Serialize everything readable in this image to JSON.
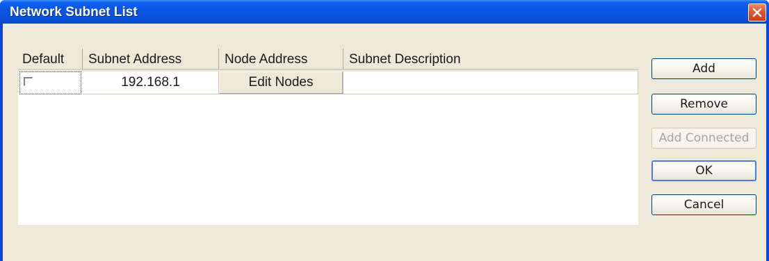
{
  "window": {
    "title": "Network Subnet List"
  },
  "table": {
    "columns": [
      "Default",
      "Subnet Address",
      "Node Address",
      "Subnet Description"
    ],
    "rows": [
      {
        "default_checked": false,
        "subnet_address": "192.168.1",
        "node_address_button": "Edit Nodes",
        "subnet_description": ""
      }
    ]
  },
  "buttons": {
    "add": "Add",
    "remove": "Remove",
    "add_connected": "Add Connected",
    "ok": "OK",
    "cancel": "Cancel"
  },
  "colors": {
    "titlebar": "#0a56e3",
    "dialog_face": "#ece9d8",
    "close_button": "#e25a32"
  },
  "icons": {
    "close": "close-x-icon"
  }
}
